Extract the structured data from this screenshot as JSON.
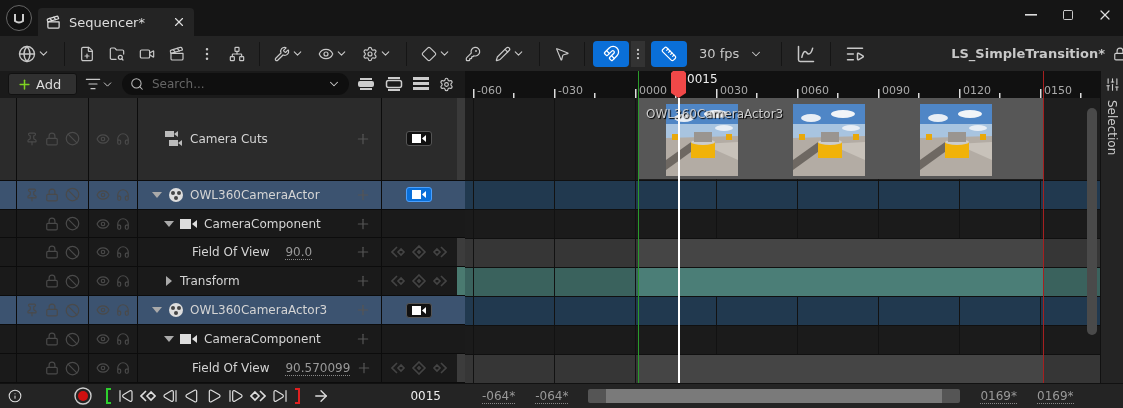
{
  "window": {
    "tab_title": "Sequencer*"
  },
  "toolbar": {
    "snap_on": true,
    "frame_snap_on": true,
    "fps": "30 fps",
    "sequence_name": "LS_SimpleTransition*"
  },
  "filter_bar": {
    "add_label": "Add",
    "search_placeholder": "Search..."
  },
  "ruler": {
    "ticks": [
      "-060",
      "-030",
      "0000",
      "0030",
      "0060",
      "0090",
      "0120",
      "0150"
    ],
    "playhead": "0015"
  },
  "section": {
    "label": "OWL360CameraActor3"
  },
  "tracks": [
    {
      "kind": "camera-cuts",
      "label": "Camera Cuts",
      "selected": false,
      "camera_on": false
    },
    {
      "kind": "actor",
      "label": "OWL360CameraActor",
      "selected": true,
      "expanded": true,
      "camera_on": true,
      "children": [
        {
          "kind": "component",
          "label": "CameraComponent",
          "selected": false,
          "expanded": true,
          "children": [
            {
              "kind": "property",
              "label": "Field Of View",
              "selected": false,
              "value": "90.0"
            }
          ]
        },
        {
          "kind": "transform",
          "label": "Transform",
          "selected": false,
          "expanded": false
        }
      ]
    },
    {
      "kind": "actor",
      "label": "OWL360CameraActor3",
      "selected": true,
      "expanded": true,
      "camera_on": false,
      "children": [
        {
          "kind": "component",
          "label": "CameraComponent",
          "selected": false,
          "expanded": true,
          "children": [
            {
              "kind": "property",
              "label": "Field Of View",
              "selected": false,
              "value": "90.570099"
            }
          ]
        }
      ]
    }
  ],
  "transport": {
    "frame": "0015",
    "view_start": "-064*",
    "work_start": "-064*",
    "work_end": "0169*",
    "view_end": "0169*"
  },
  "side_panel": {
    "label": "Selection"
  }
}
